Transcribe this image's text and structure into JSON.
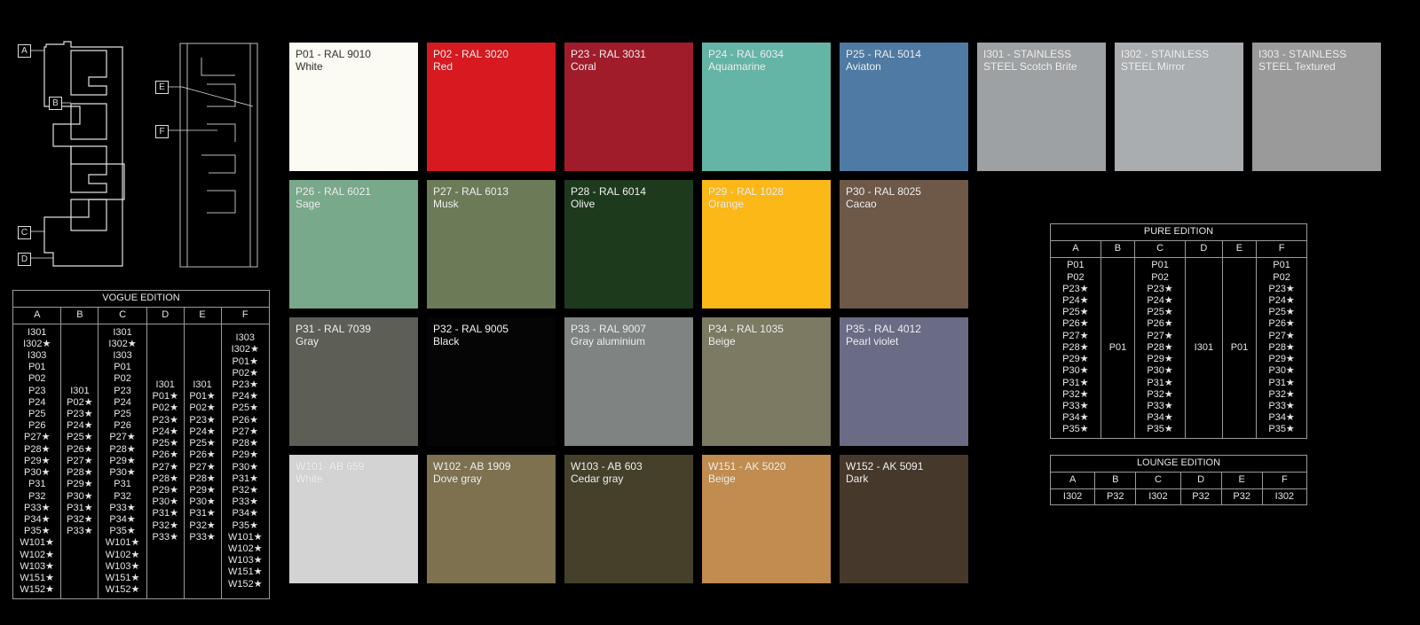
{
  "callouts": {
    "A": "A",
    "B": "B",
    "C": "C",
    "D": "D",
    "E": "E",
    "F": "F"
  },
  "vogue": {
    "title": "VOGUE EDITION",
    "cols": [
      "A",
      "B",
      "C",
      "D",
      "E",
      "F"
    ],
    "cells": [
      "I301\nI302★\nI303\nP01\nP02\nP23\nP24\nP25\nP26\nP27★\nP28★\nP29★\nP30★\nP31\nP32\nP33★\nP34★\nP35★\nW101★\nW102★\nW103★\nW151★\nW152★",
      "I301\nP02★\nP23★\nP24★\nP25★\nP26★\nP27★\nP28★\nP29★\nP30★\nP31★\nP32★\nP33★",
      "I301\nI302★\nI303\nP01\nP02\nP23\nP24\nP25\nP26\nP27★\nP28★\nP29★\nP30★\nP31\nP32\nP33★\nP34★\nP35★\nW101★\nW102★\nW103★\nW151★\nW152★",
      "I301\nP01★\nP02★\nP23★\nP24★\nP25★\nP26★\nP27★\nP28★\nP29★\nP30★\nP31★\nP32★\nP33★",
      "I301\nP01★\nP02★\nP23★\nP24★\nP25★\nP26★\nP27★\nP28★\nP29★\nP30★\nP31★\nP32★\nP33★",
      "I303\nI302★\nP01★\nP02★\nP23★\nP24★\nP25★\nP26★\nP27★\nP28★\nP29★\nP30★\nP31★\nP32★\nP33★\nP34★\nP35★\nW101★\nW102★\nW103★\nW151★\nW152★"
    ]
  },
  "pure": {
    "title": "PURE EDITION",
    "cols": [
      "A",
      "B",
      "C",
      "D",
      "E",
      "F"
    ],
    "cells": [
      "P01\nP02\nP23★\nP24★\nP25★\nP26★\nP27★\nP28★\nP29★\nP30★\nP31★\nP32★\nP33★\nP34★\nP35★",
      "P01",
      "P01\nP02\nP23★\nP24★\nP25★\nP26★\nP27★\nP28★\nP29★\nP30★\nP31★\nP32★\nP33★\nP34★\nP35★",
      "I301",
      "P01",
      "P01\nP02\nP23★\nP24★\nP25★\nP26★\nP27★\nP28★\nP29★\nP30★\nP31★\nP32★\nP33★\nP34★\nP35★"
    ]
  },
  "lounge": {
    "title": "LOUNGE EDITION",
    "cols": [
      "A",
      "B",
      "C",
      "D",
      "E",
      "F"
    ],
    "cells": [
      "I302",
      "P32",
      "I302",
      "P32",
      "P32",
      "I302"
    ]
  },
  "swatches": [
    {
      "code": "P01 - RAL 9010",
      "name": "White",
      "color": "#fbfbf3",
      "dark": true
    },
    {
      "code": "P02 - RAL 3020",
      "name": "Red",
      "color": "#d71920"
    },
    {
      "code": "P23 - RAL 3031",
      "name": "Coral",
      "color": "#a11c2b"
    },
    {
      "code": "P24 - RAL 6034",
      "name": "Aquamarine",
      "color": "#64b5a6"
    },
    {
      "code": "P25 - RAL 5014",
      "name": "Aviaton",
      "color": "#4e7aa3"
    },
    {
      "code": "I301 - STAINLESS",
      "name": "STEEL Scotch Brite",
      "color": "#9ea1a3"
    },
    {
      "code": "I302 - STAINLESS",
      "name": "STEEL Mirror",
      "color": "#a9adb0"
    },
    {
      "code": "I303 - STAINLESS",
      "name": "STEEL Textured",
      "color": "#9a9a9a"
    },
    {
      "code": "P26 - RAL 6021",
      "name": "Sage",
      "color": "#78a98a"
    },
    {
      "code": "P27 - RAL 6013",
      "name": "Musk",
      "color": "#6c7b57"
    },
    {
      "code": "P28 - RAL 6014",
      "name": "Olive",
      "color": "#1e3a1c"
    },
    {
      "code": "P29 - RAL 1028",
      "name": "Orange",
      "color": "#fbb817"
    },
    {
      "code": "P30 - RAL 8025",
      "name": "Cacao",
      "color": "#6e5847"
    },
    {
      "code": "P31 - RAL 7039",
      "name": "Gray",
      "color": "#5d5f57"
    },
    {
      "code": "P32 - RAL 9005",
      "name": "Black",
      "color": "#050505"
    },
    {
      "code": "P33 - RAL 9007",
      "name": "Gray aluminium",
      "color": "#7f8483"
    },
    {
      "code": "P34 - RAL 1035",
      "name": "Beige",
      "color": "#7c7a62"
    },
    {
      "code": "P35 - RAL 4012",
      "name": "Pearl violet",
      "color": "#6a6c86"
    },
    {
      "code": "W101- AB 659",
      "name": "White",
      "color": "#d3d3d3"
    },
    {
      "code": "W102 - AB 1909",
      "name": "Dove gray",
      "color": "#7d7150"
    },
    {
      "code": "W103 - AB 603",
      "name": "Cedar gray",
      "color": "#45402a"
    },
    {
      "code": "W151 - AK 5020",
      "name": "Beige",
      "color": "#c18c4f"
    },
    {
      "code": "W152 - AK 5091",
      "name": "Dark",
      "color": "#46382a"
    }
  ]
}
